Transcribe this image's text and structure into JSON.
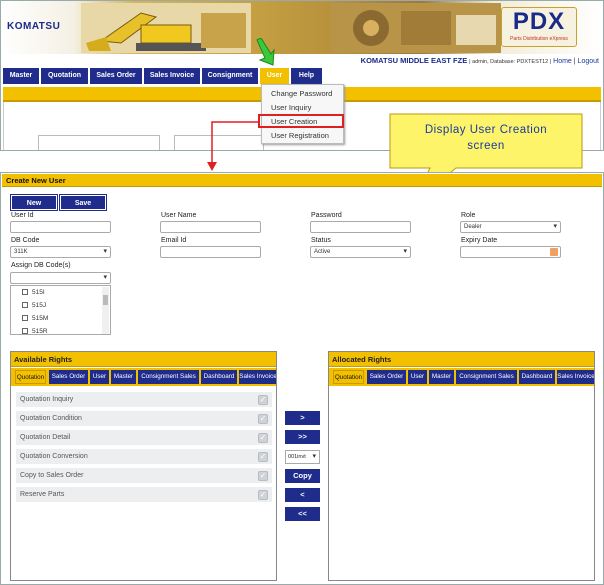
{
  "top": {
    "brand_left": "KOMATSU",
    "brand_right": "PDX",
    "brand_tagline": "Parts Distribution eXpress",
    "org_name": "KOMATSU MIDDLE EAST FZE",
    "user_info": "| admin, Database: PDXTEST12 |",
    "home_link": "Home",
    "logout_link": "Logout",
    "menu": [
      {
        "label": "Master"
      },
      {
        "label": "Quotation"
      },
      {
        "label": "Sales Order"
      },
      {
        "label": "Sales Invoice"
      },
      {
        "label": "Consignment"
      },
      {
        "label": "User"
      },
      {
        "label": "Help"
      }
    ],
    "user_dropdown": [
      "Change Password",
      "User Inquiry",
      "User Creation",
      "User Registration"
    ]
  },
  "callout": {
    "text": "Display User Creation screen"
  },
  "form": {
    "title": "Create New User",
    "new_label": "New",
    "save_label": "Save",
    "user_id_label": "User Id",
    "user_name_label": "User Name",
    "password_label": "Password",
    "role_label": "Role",
    "role_value": "Dealer",
    "db_code_label": "DB Code",
    "db_code_value": "311K",
    "email_label": "Email Id",
    "status_label": "Status",
    "status_value": "Active",
    "expiry_label": "Expiry Date",
    "assign_db_label": "Assign DB Code(s)",
    "db_codes": [
      "515I",
      "515J",
      "515M",
      "515R"
    ]
  },
  "available": {
    "title": "Available Rights",
    "tabs": [
      "Quotation",
      "Sales Order",
      "User",
      "Master",
      "Consignment Sales",
      "Dashboard",
      "Sales Invoice"
    ],
    "rights": [
      "Quotation Inquiry",
      "Quotation Condition",
      "Quotation Detail",
      "Quotation Conversion",
      "Copy to Sales Order",
      "Reserve Parts"
    ]
  },
  "mid": {
    "move_one": ">",
    "move_all": ">>",
    "select_value": "001invt",
    "copy": "Copy",
    "back_one": "<",
    "back_all": "<<"
  },
  "allocated": {
    "title": "Allocated Rights",
    "tabs": [
      "Quotation",
      "Sales Order",
      "User",
      "Master",
      "Consignment Sales",
      "Dashboard",
      "Sales Invoice"
    ]
  },
  "colors": {
    "navy": "#1f2c8c",
    "yellow": "#f3c000",
    "red_highlight": "#e02020",
    "callout_fill": "#fef46a"
  }
}
